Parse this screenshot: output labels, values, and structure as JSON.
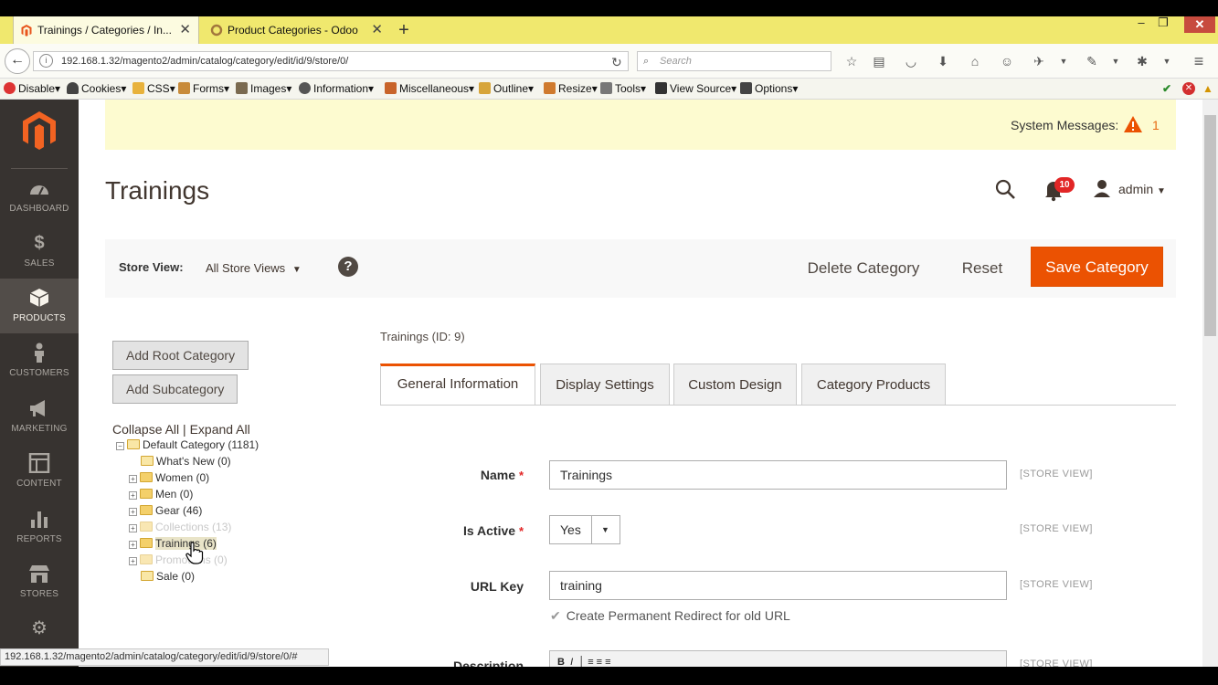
{
  "browser": {
    "tabs": [
      {
        "title": "Trainings / Categories / In...",
        "active": true
      },
      {
        "title": "Product Categories - Odoo",
        "active": false
      }
    ],
    "new_tab": "+",
    "url": "192.168.1.32/magento2/admin/catalog/category/edit/id/9/store/0/",
    "search_placeholder": "Search",
    "toolbar": [
      "Disable",
      "Cookies",
      "CSS",
      "Forms",
      "Images",
      "Information",
      "Miscellaneous",
      "Outline",
      "Resize",
      "Tools",
      "View Source",
      "Options"
    ],
    "status_url": "192.168.1.32/magento2/admin/catalog/category/edit/id/9/store/0/#"
  },
  "sidebar": {
    "items": [
      {
        "label": "DASHBOARD",
        "icon": "dashboard-icon"
      },
      {
        "label": "SALES",
        "icon": "dollar-icon"
      },
      {
        "label": "PRODUCTS",
        "icon": "box-icon",
        "active": true
      },
      {
        "label": "CUSTOMERS",
        "icon": "person-icon"
      },
      {
        "label": "MARKETING",
        "icon": "megaphone-icon"
      },
      {
        "label": "CONTENT",
        "icon": "layout-icon"
      },
      {
        "label": "REPORTS",
        "icon": "bars-icon"
      },
      {
        "label": "STORES",
        "icon": "store-icon"
      },
      {
        "label": "",
        "icon": "gear-icon"
      }
    ]
  },
  "system_messages": {
    "label": "System Messages:",
    "count": "1"
  },
  "header": {
    "title": "Trainings",
    "notifications": "10",
    "user": "admin"
  },
  "actions": {
    "store_view_label": "Store View:",
    "store_view_value": "All Store Views",
    "help": "?",
    "delete": "Delete Category",
    "reset": "Reset",
    "save": "Save Category"
  },
  "tree": {
    "add_root": "Add Root Category",
    "add_sub": "Add Subcategory",
    "collapse_all": "Collapse All",
    "separator": "|",
    "expand_all": "Expand All",
    "items": [
      {
        "label": "Default Category (1181)",
        "expander": "⊟"
      },
      {
        "label": "What's New (0)",
        "expander": ""
      },
      {
        "label": "Women (0)",
        "expander": "⊞"
      },
      {
        "label": "Men (0)",
        "expander": "⊞"
      },
      {
        "label": "Gear (46)",
        "expander": "⊞"
      },
      {
        "label": "Collections (13)",
        "expander": "⊞",
        "dim": true
      },
      {
        "label": "Trainings (6)",
        "expander": "⊞",
        "selected": true
      },
      {
        "label": "Promotions (0)",
        "expander": "⊞",
        "dim": true
      },
      {
        "label": "Sale (0)",
        "expander": ""
      }
    ]
  },
  "category": {
    "info": "Trainings (ID: 9)",
    "tabs": [
      "General Information",
      "Display Settings",
      "Custom Design",
      "Category Products"
    ],
    "form": {
      "name_label": "Name",
      "name_value": "Trainings",
      "active_label": "Is Active",
      "active_value": "Yes",
      "urlkey_label": "URL Key",
      "urlkey_value": "training",
      "redirect_label": "Create Permanent Redirect for old URL",
      "desc_label": "Description",
      "scope": "[STORE VIEW]",
      "required": "*"
    }
  },
  "colors": {
    "accent": "#eb5202",
    "sidebar": "#373330",
    "message_bg": "#fdfbd0"
  }
}
